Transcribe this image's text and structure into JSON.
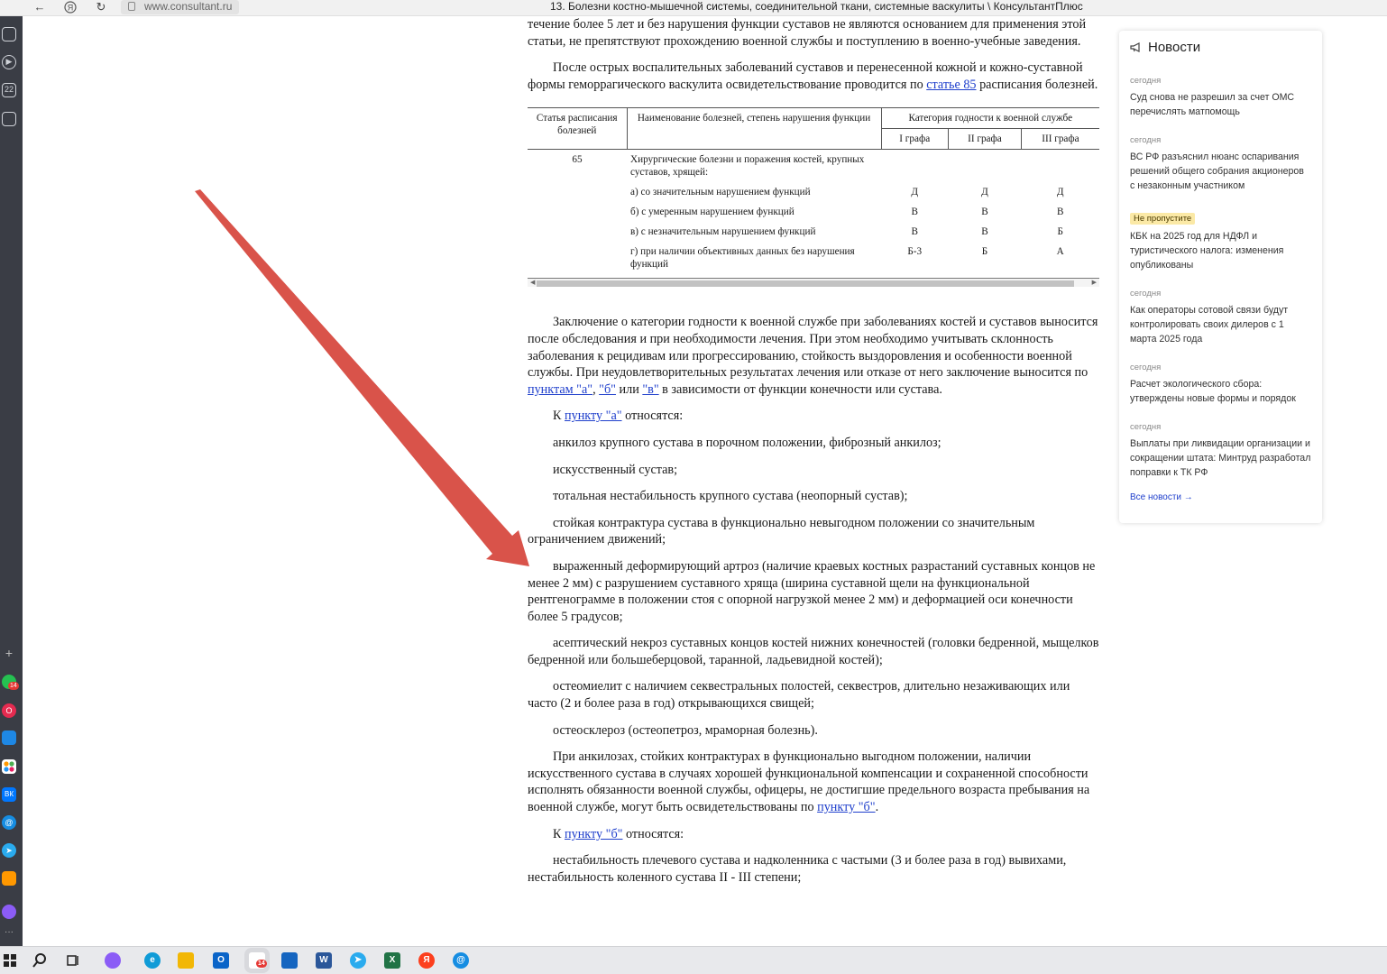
{
  "browser": {
    "url": "www.consultant.ru",
    "page_title": "13. Болезни костно-мышечной системы, соединительной ткани, системные васкулиты \\ КонсультантПлюс"
  },
  "doc": {
    "p1": "течение более 5 лет и без нарушения функции суставов не являются основанием для применения этой статьи, не препятствуют прохождению военной службы и поступлению в военно-учебные заведения.",
    "p2_before": "После острых воспалительных заболеваний суставов и перенесенной кожной и кожно-суставной формы геморрагического васкулита освидетельствование проводится по ",
    "p2_link": "статье 85",
    "p2_after": " расписания болезней.",
    "table": {
      "col1": "Статья расписания болезней",
      "col2": "Наименование болезней, степень нарушения функции",
      "col3": "Категория годности к военной службе",
      "sub1": "I графа",
      "sub2": "II графа",
      "sub3": "III графа",
      "article": "65",
      "heading": "Хирургические болезни и поражения костей, крупных суставов, хрящей:",
      "rows": [
        {
          "name": "а) со значительным нарушением функций",
          "g1": "Д",
          "g2": "Д",
          "g3": "Д"
        },
        {
          "name": "б) с умеренным нарушением функций",
          "g1": "В",
          "g2": "В",
          "g3": "В"
        },
        {
          "name": "в) с незначительным нарушением функций",
          "g1": "В",
          "g2": "В",
          "g3": "Б"
        },
        {
          "name": "г) при наличии объективных данных без нарушения функций",
          "g1": "Б-3",
          "g2": "Б",
          "g3": "А"
        }
      ]
    },
    "p3_before": "Заключение о категории годности к военной службе при заболеваниях костей и суставов выносится после обследования и при необходимости лечения. При этом необходимо учитывать склонность заболевания к рецидивам или прогрессированию, стойкость выздоровления и особенности военной службы. При неудовлетворительных результатах лечения или отказе от него заключение выносится по ",
    "p3_link1": "пунктам \"а\"",
    "p3_sep1": ", ",
    "p3_link2": "\"б\"",
    "p3_sep2": " или ",
    "p3_link3": "\"в\"",
    "p3_after": " в зависимости от функции конечности или сустава.",
    "k_a_before": "К ",
    "k_a_link": "пункту \"а\"",
    "k_a_after": " относятся:",
    "a1": "анкилоз крупного сустава в порочном положении, фиброзный анкилоз;",
    "a2": "искусственный сустав;",
    "a3": "тотальная нестабильность крупного сустава (неопорный сустав);",
    "a4": "стойкая контрактура сустава в функционально невыгодном положении со значительным ограничением движений;",
    "a5": "выраженный деформирующий артроз (наличие краевых костных разрастаний суставных концов не менее 2 мм) с разрушением суставного хряща (ширина суставной щели на функциональной рентгенограмме в положении стоя с опорной нагрузкой менее 2 мм) и деформацией оси конечности более 5 градусов;",
    "a6": "асептический некроз суставных концов костей нижних конечностей (головки бедренной, мыщелков бедренной или большеберцовой, таранной, ладьевидной костей);",
    "a7": "остеомиелит с наличием секвестральных полостей, секвестров, длительно незаживающих или часто (2 и более раза в год) открывающихся свищей;",
    "a8": "остеосклероз (остеопетроз, мраморная болезнь).",
    "p4_before": "При анкилозах, стойких контрактурах в функционально выгодном положении, наличии искусственного сустава в случаях хорошей функциональной компенсации и сохраненной способности исполнять обязанности военной службы, офицеры, не достигшие предельного возраста пребывания на военной службе, могут быть освидетельствованы по ",
    "p4_link": "пункту \"б\"",
    "p4_after": ".",
    "k_b_before": "К ",
    "k_b_link": "пункту \"б\"",
    "k_b_after": " относятся:",
    "b1": "нестабильность плечевого сустава и надколенника с частыми (3 и более раза в год) вывихами, нестабильность коленного сустава II - III степени;"
  },
  "news": {
    "header": "Новости",
    "items": [
      {
        "date": "сегодня",
        "text": "Суд снова не разрешил за счет ОМС перечислять матпомощь"
      },
      {
        "date": "сегодня",
        "text": "ВС РФ разъяснил нюанс оспаривания решений общего собрания акционеров с незаконным участником"
      },
      {
        "badge": "Не пропустите",
        "text": "КБК на 2025 год для НДФЛ и туристического налога: изменения опубликованы"
      },
      {
        "date": "сегодня",
        "text": "Как операторы сотовой связи будут контролировать своих дилеров с 1 марта 2025 года"
      },
      {
        "date": "сегодня",
        "text": "Расчет экологического сбора: утверждены новые формы и порядок"
      },
      {
        "date": "сегодня",
        "text": "Выплаты при ликвидации организации и сокращении штата: Минтруд разработал поправки к ТК РФ"
      }
    ],
    "all_label": "Все новости →"
  },
  "sidebar": {
    "badge_whatsapp": "14",
    "icon_22": "22",
    "icon_vk": "ВК"
  },
  "taskbar": {
    "badge_mail": "14",
    "word_letter": "W",
    "excel_letter": "X",
    "yandex_letter": "Я"
  },
  "colors": {
    "arrow": "#d9534a",
    "link": "#1f3fcc",
    "sidebar": "#3a3d45"
  }
}
